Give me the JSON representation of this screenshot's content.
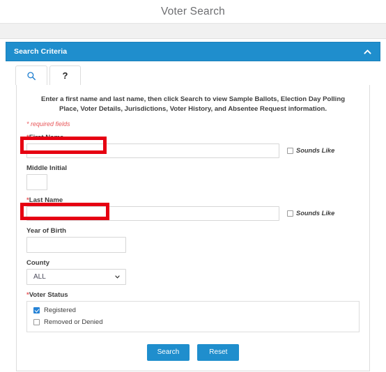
{
  "page": {
    "title": "Voter Search"
  },
  "panel": {
    "title": "Search Criteria",
    "collapse_icon": "chevron-up-icon"
  },
  "tabs": [
    {
      "id": "search",
      "icon": "search-icon",
      "label": "",
      "active": true
    },
    {
      "id": "help",
      "icon": "question-mark-icon",
      "label": "?",
      "active": false
    }
  ],
  "form": {
    "instructions": "Enter a first name and last name, then click Search to view Sample Ballots, Election Day Polling Place, Voter Details, Jurisdictions, Voter History, and Absentee Request information.",
    "required_note": "* required fields",
    "required_marker": "*",
    "fields": {
      "first_name": {
        "label": "First Name",
        "required": true,
        "value": "",
        "placeholder": "",
        "sounds_like_label": "Sounds Like",
        "sounds_like_checked": false
      },
      "middle_initial": {
        "label": "Middle Initial",
        "required": false,
        "value": "",
        "placeholder": ""
      },
      "last_name": {
        "label": "Last Name",
        "required": true,
        "value": "",
        "placeholder": "",
        "sounds_like_label": "Sounds Like",
        "sounds_like_checked": false
      },
      "year_of_birth": {
        "label": "Year of Birth",
        "required": false,
        "value": "",
        "placeholder": ""
      },
      "county": {
        "label": "County",
        "required": false,
        "selected": "ALL",
        "options": [
          "ALL"
        ]
      },
      "voter_status": {
        "label": "Voter Status",
        "required": true,
        "options": [
          {
            "label": "Registered",
            "checked": true
          },
          {
            "label": "Removed or Denied",
            "checked": false
          }
        ]
      }
    },
    "buttons": {
      "search": "Search",
      "reset": "Reset"
    }
  },
  "colors": {
    "accent_blue": "#1f8ecd",
    "required_red": "#e8575a",
    "annotation_red": "#e60012",
    "title_gray": "#6d6e71"
  }
}
